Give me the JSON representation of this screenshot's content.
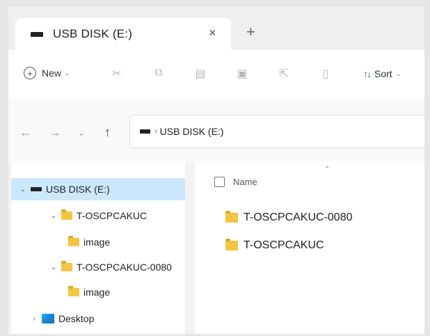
{
  "tab": {
    "title": "USB DISK (E:)",
    "close": "×",
    "new_tab": "+"
  },
  "toolbar": {
    "new_label": "New",
    "new_caret": "⌄",
    "sort_label": "Sort",
    "sort_caret": "⌄",
    "icons": [
      "cut-icon",
      "copy-icon",
      "paste-icon",
      "rename-icon",
      "share-icon",
      "delete-icon"
    ]
  },
  "nav": {
    "back": "←",
    "forward": "→",
    "recent": "⌄",
    "up": "↑"
  },
  "address": {
    "separator": "›",
    "crumb": "USB DISK (E:)"
  },
  "sidebar": {
    "items": [
      {
        "label": "USB DISK (E:)",
        "chevron": "⌄",
        "icon": "drive-icon",
        "selected": true
      },
      {
        "label": "T-OSCPCAKUC",
        "chevron": "⌄",
        "icon": "folder-icon"
      },
      {
        "label": "image",
        "chevron": "",
        "icon": "folder-icon"
      },
      {
        "label": "T-OSCPCAKUC-0080",
        "chevron": "⌄",
        "icon": "folder-icon"
      },
      {
        "label": "image",
        "chevron": "",
        "icon": "folder-icon"
      },
      {
        "label": "Desktop",
        "chevron": "›",
        "icon": "desktop-icon"
      }
    ]
  },
  "content": {
    "column_name": "Name",
    "sort_indicator": "⌃",
    "files": [
      {
        "name": "T-OSCPCAKUC-0080",
        "icon": "folder-icon"
      },
      {
        "name": "T-OSCPCAKUC",
        "icon": "folder-icon"
      }
    ]
  },
  "colors": {
    "selected_bg": "#cce8ff",
    "folder": "#f4c542",
    "accent": "#2a68c4"
  }
}
